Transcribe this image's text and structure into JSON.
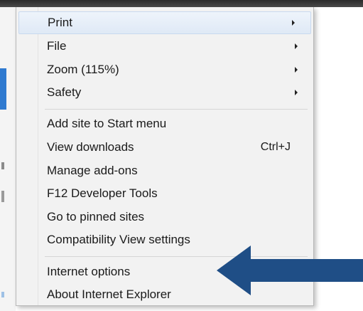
{
  "menu": {
    "items": [
      {
        "label": "Print",
        "submenu": true
      },
      {
        "label": "File",
        "submenu": true
      },
      {
        "label": "Zoom (115%)",
        "submenu": true
      },
      {
        "label": "Safety",
        "submenu": true
      },
      {
        "label": "Add site to Start menu"
      },
      {
        "label": "View downloads",
        "shortcut": "Ctrl+J"
      },
      {
        "label": "Manage add-ons"
      },
      {
        "label": "F12 Developer Tools"
      },
      {
        "label": "Go to pinned sites"
      },
      {
        "label": "Compatibility View settings"
      },
      {
        "label": "Internet options"
      },
      {
        "label": "About Internet Explorer"
      }
    ]
  },
  "annotation": {
    "arrow_icon": "left-arrow-icon",
    "arrow_color": "#1f4e86",
    "points_to": "Internet options"
  },
  "colors": {
    "menu_background": "#f2f2f2",
    "highlight": "#dfe9f6"
  }
}
